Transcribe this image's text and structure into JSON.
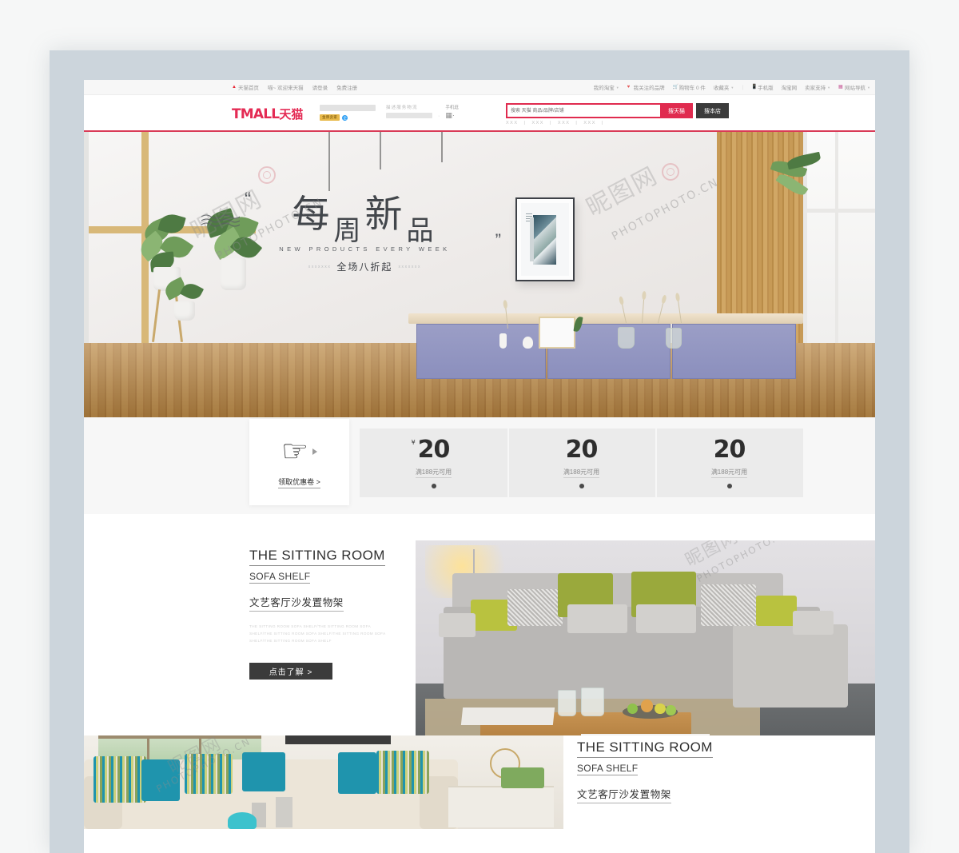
{
  "site": {
    "brand_logo_en": "TMALL",
    "brand_logo_cn": "天猫",
    "accent_red": "#e02b4f",
    "dark_button": "#3b3b3b"
  },
  "topbar": {
    "left_items": [
      {
        "icon": "home-icon",
        "label": "天猫首页"
      },
      {
        "icon": "none",
        "label": "喵~ 欢迎来天猫"
      },
      {
        "icon": "none",
        "label": "请登录"
      },
      {
        "icon": "none",
        "label": "免费注册"
      }
    ],
    "right_items": [
      {
        "icon": "none",
        "label": "我的淘宝",
        "caret": true
      },
      {
        "icon": "heart-icon",
        "label": "我关注的品牌",
        "caret": false
      },
      {
        "icon": "cart-icon",
        "label": "购物车 0 件",
        "caret": false
      },
      {
        "icon": "none",
        "label": "收藏夹",
        "caret": true
      },
      {
        "icon": "phone-icon",
        "label": "手机版",
        "caret": false
      },
      {
        "icon": "none",
        "label": "淘宝网",
        "caret": false
      },
      {
        "icon": "none",
        "label": "卖家支持",
        "caret": true
      },
      {
        "icon": "grid-icon",
        "label": "网站导航",
        "caret": true
      }
    ]
  },
  "header": {
    "shop_badge_gold": "金牌卖家",
    "shop_badge_blue": "企",
    "nav_text_placeholder": "描述服务物流",
    "nav_caret": "·",
    "phone_label": "手机逛",
    "qr_icon": "qr-code-icon"
  },
  "search": {
    "placeholder": "搜索 天猫 商品/品牌/店铺",
    "value": "",
    "button_tmall": "搜天猫",
    "button_shop": "搜本店",
    "hot_words": [
      "XXX",
      "XXX",
      "XXX",
      "XXX"
    ]
  },
  "hero": {
    "title_chars": [
      "每",
      "周",
      "新",
      "品"
    ],
    "subtitle_en": "NEW PRODUCTS EVERY WEEK",
    "promo": "全场八折起",
    "promo_deco_left": "xxxxxxx",
    "promo_deco_right": "xxxxxxx",
    "quote_open": "“",
    "quote_close": "”",
    "art_letter": "B"
  },
  "coupons": {
    "cta_label": "领取优惠卷 >",
    "cta_icon": "pointing-hand-icon",
    "cta_arrow_icon": "play-triangle-icon",
    "currency": "¥",
    "items": [
      {
        "amount": "20",
        "condition": "满188元可用",
        "show_currency": true
      },
      {
        "amount": "20",
        "condition": "满188元可用",
        "show_currency": false
      },
      {
        "amount": "20",
        "condition": "满188元可用",
        "show_currency": false
      }
    ]
  },
  "sections": [
    {
      "title_en": "THE SITTING ROOM",
      "subtitle_en": "SOFA SHELF",
      "title_cn": "文艺客厅沙发置物架",
      "description": "THE SITTING ROOM SOFA SHELF/THE SITTING ROOM SOFA SHELF/THE SITTING ROOM SOFA SHELF/THE SITTING ROOM SOFA SHELF/THE SITTING ROOM SOFA SHELF",
      "button": "点击了解 >",
      "image_alt": "grey-sectional-sofa-with-green-pillows"
    },
    {
      "title_en": "THE SITTING ROOM",
      "subtitle_en": "SOFA SHELF",
      "title_cn": "文艺客厅沙发置物架",
      "image_alt": "cream-sectional-sofa-with-teal-pillows"
    }
  ],
  "watermark": {
    "latin": "PHOTOPHOTO.CN",
    "cn": "昵图网"
  }
}
